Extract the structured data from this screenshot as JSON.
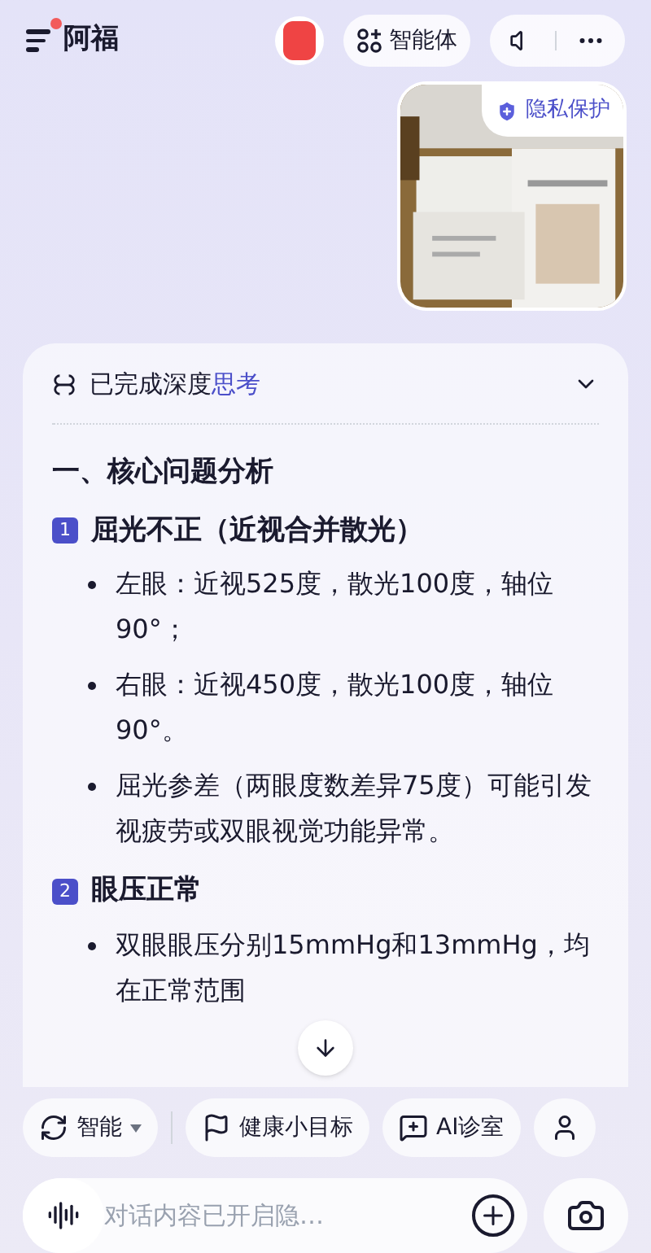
{
  "header": {
    "title": "阿福",
    "has_notification": true,
    "agent_button": "智能体"
  },
  "photo": {
    "kind": "picture",
    "badge": "隐私保护"
  },
  "thinking": {
    "label_plain": "已完成深度",
    "label_accent": "思考",
    "expanded": false
  },
  "heading": "一、核心问题分析",
  "sections": [
    {
      "number": "1",
      "title": "屈光不正（近视合并散光）",
      "bullets": [
        "左眼：近视525度，散光100度，轴位90°；",
        "右眼：近视450度，散光100度，轴位90°。",
        "屈光参差（两眼度数差异75度）可能引发视疲劳或双眼视觉功能异常。"
      ]
    },
    {
      "number": "2",
      "title": "眼压正常",
      "bullets": [
        "双眼眼压分别15mmHg和13mmHg，均在正常范围"
      ]
    }
  ],
  "chips": [
    {
      "kind": "mode",
      "label": "智能"
    },
    {
      "kind": "flag",
      "label": "健康小目标"
    },
    {
      "kind": "chat",
      "label": "AI诊室"
    },
    {
      "kind": "person"
    }
  ],
  "input": {
    "placeholder": "对话内容已开启隐…"
  }
}
